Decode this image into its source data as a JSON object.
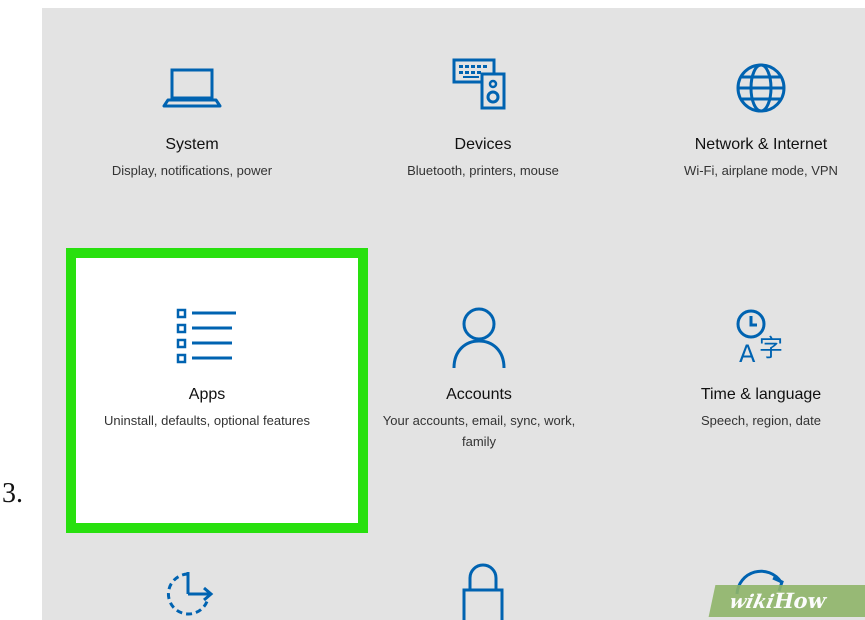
{
  "step_number": "3.",
  "accent_color": "#0063b1",
  "highlight_color": "#28e00e",
  "tiles": [
    {
      "icon": "laptop-icon",
      "title": "System",
      "description": "Display, notifications, power"
    },
    {
      "icon": "devices-icon",
      "title": "Devices",
      "description": "Bluetooth, printers, mouse"
    },
    {
      "icon": "globe-icon",
      "title": "Network & Internet",
      "description": "Wi-Fi, airplane mode, VPN"
    },
    {
      "icon": "apps-list-icon",
      "title": "Apps",
      "description": "Uninstall, defaults, optional features"
    },
    {
      "icon": "person-icon",
      "title": "Accounts",
      "description": "Your accounts, email, sync, work, family"
    },
    {
      "icon": "time-language-icon",
      "title": "Time & language",
      "description": "Speech, region, date"
    },
    {
      "icon": "update-arrow-icon",
      "title": "",
      "description": ""
    },
    {
      "icon": "lock-icon",
      "title": "",
      "description": ""
    },
    {
      "icon": "sync-icon",
      "title": "",
      "description": ""
    }
  ],
  "watermark": {
    "part1": "wiki",
    "part2": "How"
  }
}
